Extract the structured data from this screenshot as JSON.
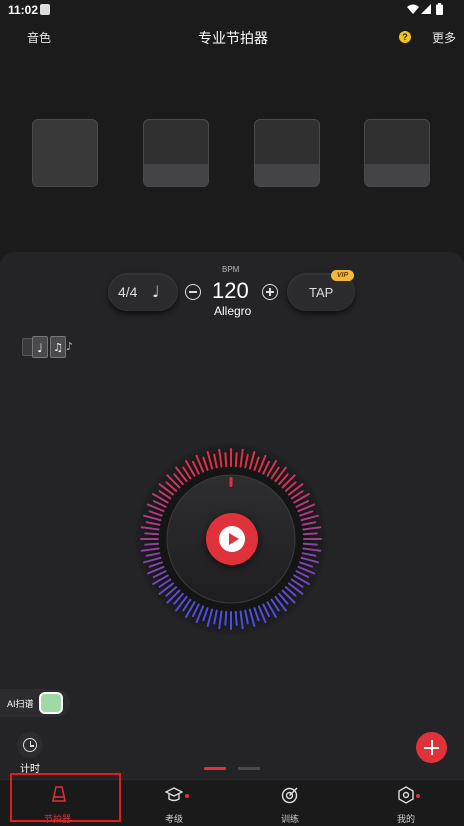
{
  "status_bar": {
    "time": "11:02"
  },
  "header": {
    "tone_label": "音色",
    "title": "专业节拍器",
    "help_icon": "?",
    "more_label": "更多"
  },
  "controls": {
    "time_signature": "4/4",
    "note_glyph": "♩",
    "bpm_label": "BPM",
    "bpm_value": "120",
    "tempo_name": "Allegro",
    "minus": "−",
    "plus": "+",
    "tap_label": "TAP",
    "vip_badge": "VIP"
  },
  "side": {
    "ai_scan_label": "AI扫谱",
    "timer_label": "计时"
  },
  "nav": {
    "items": [
      {
        "label": "节拍器",
        "active": true
      },
      {
        "label": "考级",
        "dot": true
      },
      {
        "label": "训练"
      },
      {
        "label": "我的",
        "dot": true
      }
    ]
  },
  "colors": {
    "accent": "#e03238",
    "dial_red": "#e0304a",
    "dial_blue": "#4a4fe0"
  }
}
